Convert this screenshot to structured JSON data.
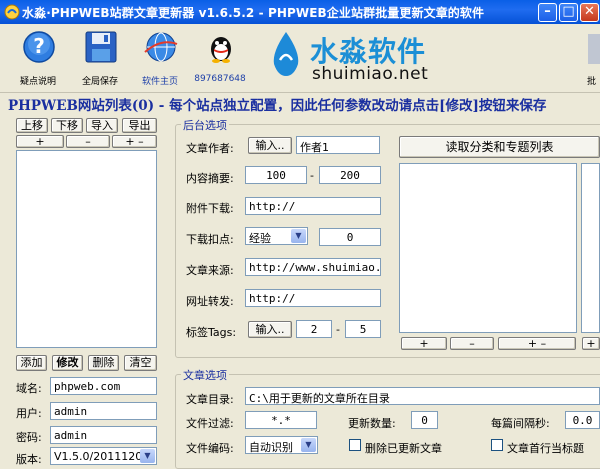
{
  "window": {
    "title": "水淼·PHPWEB站群文章更新器 v1.6.5.2 - PHPWEB企业站群批量更新文章的软件",
    "minimize": "–",
    "maximize": "□",
    "close": "✕"
  },
  "toolbar": {
    "items": [
      {
        "label": "疑点说明",
        "icon": "help-icon"
      },
      {
        "label": "全局保存",
        "icon": "save-icon"
      },
      {
        "label": "软件主页",
        "icon": "globe-icon"
      },
      {
        "label": "897687648",
        "icon": "qq-icon"
      }
    ],
    "brand_cn": "水淼软件",
    "brand_en": "shuimiao.net",
    "right_label": "批"
  },
  "header": "PHPWEB网站列表(0) - 每个站点独立配置，因此任何参数改动请点击[修改]按钮来保存",
  "site_list": {
    "buttons_top": [
      "上移",
      "下移",
      "导入",
      "导出"
    ],
    "buttons_plus": [
      "+",
      "–",
      "+ –"
    ],
    "buttons_bottom": [
      "添加",
      "修改",
      "删除",
      "清空"
    ],
    "domain_label": "域名:",
    "domain_value": "phpweb.com",
    "user_label": "用户:",
    "user_value": "admin",
    "password_label": "密码:",
    "password_value": "admin",
    "version_label": "版本:",
    "version_value": "V1.5.0/20111209"
  },
  "backend": {
    "title": "后台选项",
    "author_label": "文章作者:",
    "author_btn": "输入..",
    "author_value": "作者1",
    "summary_label": "内容摘要:",
    "summary_min": "100",
    "summary_dash": "-",
    "summary_max": "200",
    "attach_label": "附件下载:",
    "attach_value": "http://",
    "deduct_label": "下载扣点:",
    "deduct_type": "经验",
    "deduct_value": "0",
    "source_label": "文章来源:",
    "source_value": "http://www.shuimiao.net",
    "redirect_label": "网址转发:",
    "redirect_value": "http://",
    "tags_label": "标签Tags:",
    "tags_btn": "输入..",
    "tags_min": "2",
    "tags_dash": "-",
    "tags_max": "5",
    "read_btn": "读取分类和专题列表",
    "list_buttons": [
      "+",
      "–",
      "+ –",
      "+"
    ]
  },
  "article": {
    "title": "文章选项",
    "dir_label": "文章目录:",
    "dir_value": "C:\\用于更新的文章所在目录",
    "filter_label": "文件过滤:",
    "filter_value": "*.*",
    "count_label": "更新数量:",
    "count_value": "0",
    "interval_label": "每篇间隔秒:",
    "interval_value": "0.0",
    "encoding_label": "文件编码:",
    "encoding_value": "自动识别",
    "delete_label": "删除已更新文章",
    "firstline_label": "文章首行当标题"
  }
}
